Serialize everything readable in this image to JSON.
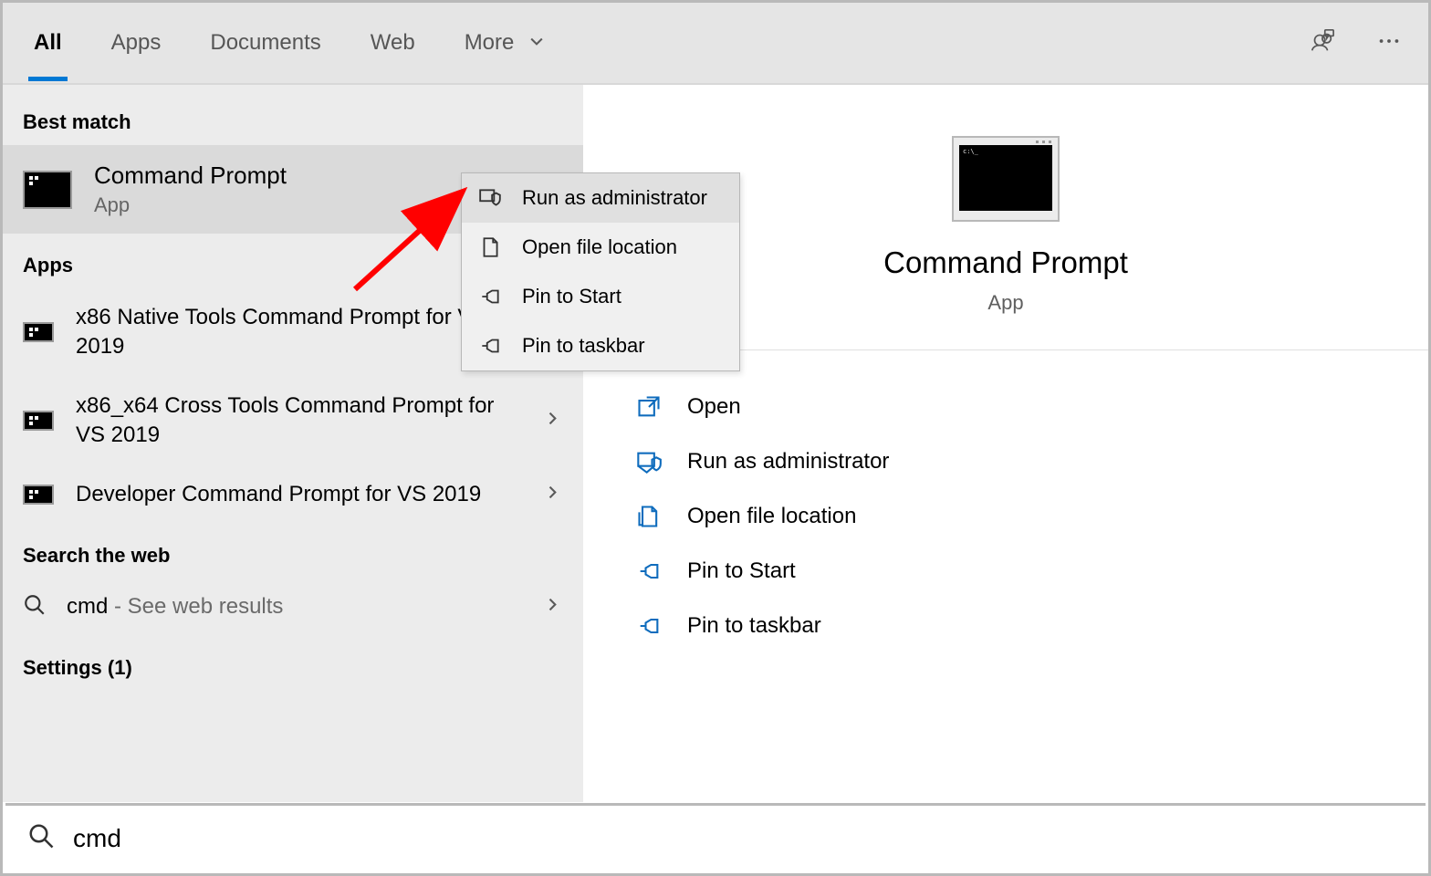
{
  "topbar": {
    "tabs": {
      "all": "All",
      "apps": "Apps",
      "documents": "Documents",
      "web": "Web",
      "more": "More"
    }
  },
  "left": {
    "best_match_header": "Best match",
    "best_match": {
      "title": "Command Prompt",
      "subtitle": "App"
    },
    "apps_header": "Apps",
    "apps": [
      "x86 Native Tools Command Prompt for VS 2019",
      "x86_x64 Cross Tools Command Prompt for VS 2019",
      "Developer Command Prompt for VS 2019"
    ],
    "web_header": "Search the web",
    "web_query": "cmd",
    "web_hint": " - See web results",
    "settings_header": "Settings (1)"
  },
  "context_menu": {
    "items": [
      "Run as administrator",
      "Open file location",
      "Pin to Start",
      "Pin to taskbar"
    ]
  },
  "right": {
    "title": "Command Prompt",
    "subtitle": "App",
    "actions": [
      "Open",
      "Run as administrator",
      "Open file location",
      "Pin to Start",
      "Pin to taskbar"
    ]
  },
  "search": {
    "value": "cmd"
  }
}
